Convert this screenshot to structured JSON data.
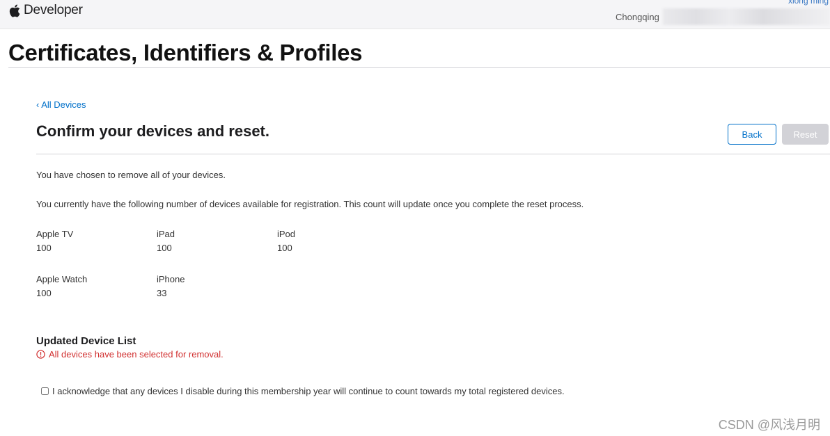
{
  "header": {
    "brand": "Developer",
    "user_name": "xiong ming",
    "team_name": "Chongqing"
  },
  "page": {
    "title": "Certificates, Identifiers & Profiles",
    "back_link": "‹ All Devices",
    "section_title": "Confirm your devices and reset.",
    "buttons": {
      "back": "Back",
      "reset": "Reset"
    },
    "paragraph1": "You have chosen to remove all of your devices.",
    "paragraph2": "You currently have the following number of devices available for registration. This count will update once you complete the reset process."
  },
  "devices": [
    {
      "name": "Apple TV",
      "count": "100"
    },
    {
      "name": "iPad",
      "count": "100"
    },
    {
      "name": "iPod",
      "count": "100"
    },
    {
      "name": "Apple Watch",
      "count": "100"
    },
    {
      "name": "iPhone",
      "count": "33"
    }
  ],
  "updated": {
    "title": "Updated Device List",
    "warning": "All devices have been selected for removal."
  },
  "acknowledge": {
    "label": "I acknowledge that any devices I disable during this membership year will continue to count towards my total registered devices.",
    "checked": false
  },
  "watermark": "CSDN @风浅月明",
  "colors": {
    "link": "#0070c9",
    "error": "#d12f2f",
    "reset_disabled": "#d2d2d7"
  },
  "icons": [
    "apple-logo-icon",
    "error-circle-icon",
    "checkbox"
  ]
}
